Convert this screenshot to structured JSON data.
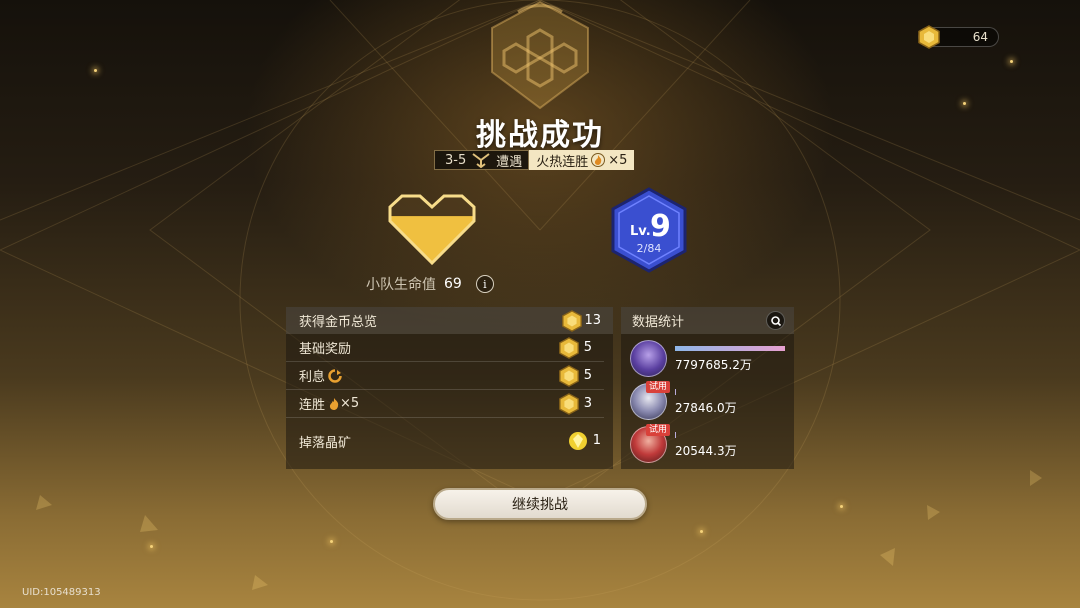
{
  "top_bar": {
    "currency_icon": "gold-hex-coin-icon",
    "currency_value": "64"
  },
  "result": {
    "title": "挑战成功",
    "stage": "3-5",
    "encounter_icon": "encounter-path-icon",
    "encounter_label": "遭遇",
    "streak_label": "火热连胜",
    "streak_icon": "flame-icon",
    "streak_mult": "×5"
  },
  "team": {
    "hp_label": "小队生命值",
    "hp_value": "69",
    "info_icon": "i",
    "heart_icon": "gold-heart-icon",
    "heart_fill_fraction": 0.7
  },
  "level": {
    "prefix": "Lv.",
    "value": "9",
    "progress": "2/84",
    "progress_current": 2,
    "progress_total": 84
  },
  "gold_summary": {
    "header_label": "获得金币总览",
    "header_value": "13",
    "rows": [
      {
        "label": "基础奖励",
        "icon": "gold-hex-coin-icon",
        "value": "5"
      },
      {
        "label": "利息",
        "label_icon": "interest-arrow-icon",
        "icon": "gold-hex-coin-icon",
        "value": "5"
      },
      {
        "label": "连胜",
        "label_icon": "flame-icon",
        "label_suffix": "×5",
        "icon": "gold-hex-coin-icon",
        "value": "3"
      },
      {
        "label": "掉落晶矿",
        "icon": "crystal-ore-icon",
        "value": "1"
      }
    ]
  },
  "stats": {
    "header_label": "数据统计",
    "search_icon": "search-icon",
    "entries": [
      {
        "value": "7797685.2万",
        "trial": "",
        "bar_fraction": 1.0
      },
      {
        "value": "27846.0万",
        "trial": "试用",
        "bar_fraction": 0.004
      },
      {
        "value": "20544.3万",
        "trial": "试用",
        "bar_fraction": 0.003
      }
    ]
  },
  "actions": {
    "continue_label": "继续挑战"
  },
  "footer": {
    "uid": "UID:105489313"
  },
  "colors": {
    "gold": "#f0c040",
    "level_blue": "#3a4fd0",
    "trial_red": "#d9413a",
    "bar_start": "#8fb7e8",
    "bar_end": "#e6a0d0"
  }
}
